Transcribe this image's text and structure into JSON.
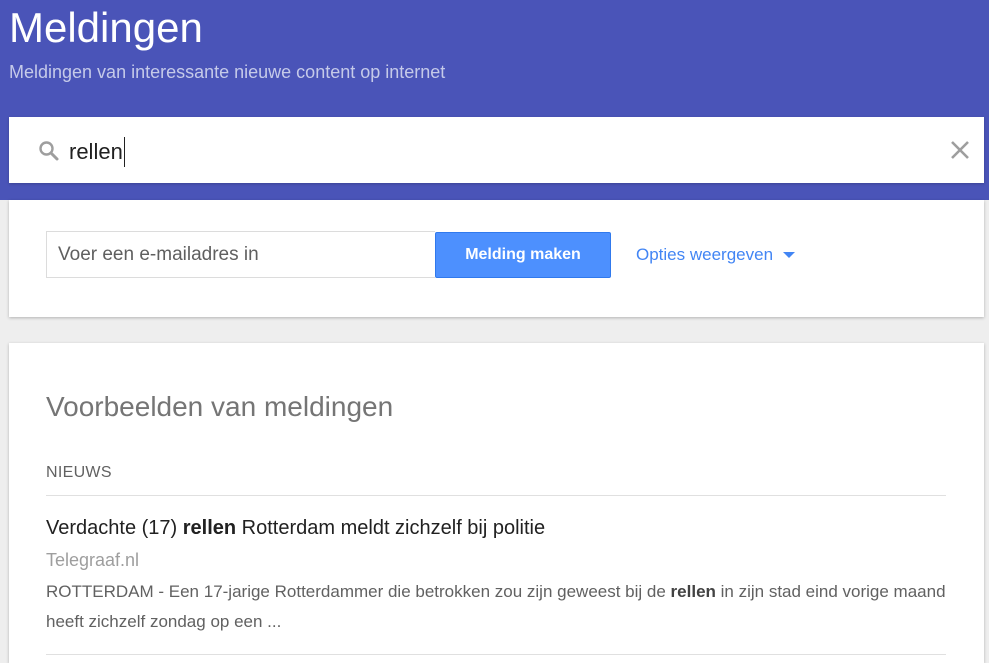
{
  "header": {
    "title": "Meldingen",
    "subtitle": "Meldingen van interessante nieuwe content op internet"
  },
  "search": {
    "value": "rellen",
    "icon": "search-icon",
    "clear_icon": "close-icon"
  },
  "create": {
    "email_placeholder": "Voer een e-mailadres in",
    "button_label": "Melding maken",
    "options_label": "Opties weergeven",
    "options_icon": "caret-down-icon"
  },
  "examples": {
    "title": "Voorbeelden van meldingen",
    "section_label": "NIEUWS",
    "results": [
      {
        "title_before": "Verdachte (17) ",
        "title_highlight": "rellen",
        "title_after": " Rotterdam meldt zichzelf bij politie",
        "source": "Telegraaf.nl",
        "snippet_before": "ROTTERDAM - Een 17-jarige Rotterdammer die betrokken zou zijn geweest bij de ",
        "snippet_highlight": "rellen",
        "snippet_after": " in zijn stad eind vorige maand heeft zichzelf zondag op een ..."
      }
    ]
  },
  "colors": {
    "header_bg": "#4a54b8",
    "button_bg": "#4d90fe",
    "link": "#4285f4"
  }
}
